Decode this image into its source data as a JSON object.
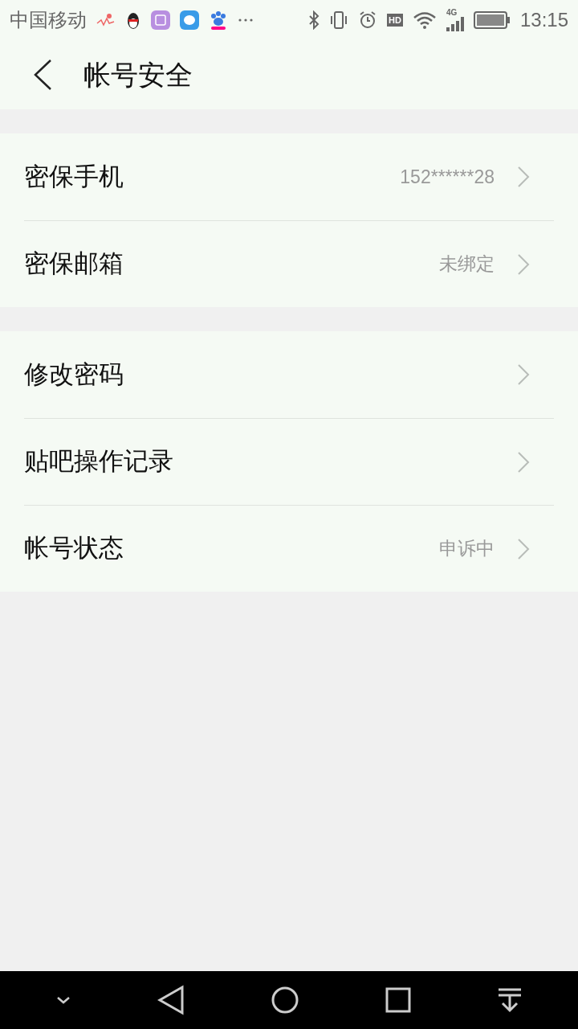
{
  "status_bar": {
    "carrier": "中国移动",
    "hd": "HD",
    "network": "4G",
    "time": "13:15"
  },
  "header": {
    "title": "帐号安全"
  },
  "groups": [
    {
      "rows": [
        {
          "label": "密保手机",
          "value": "152******28"
        },
        {
          "label": "密保邮箱",
          "value": "未绑定"
        }
      ]
    },
    {
      "rows": [
        {
          "label": "修改密码"
        },
        {
          "label": "贴吧操作记录"
        },
        {
          "label": "帐号状态",
          "value": "申诉中"
        }
      ]
    }
  ]
}
